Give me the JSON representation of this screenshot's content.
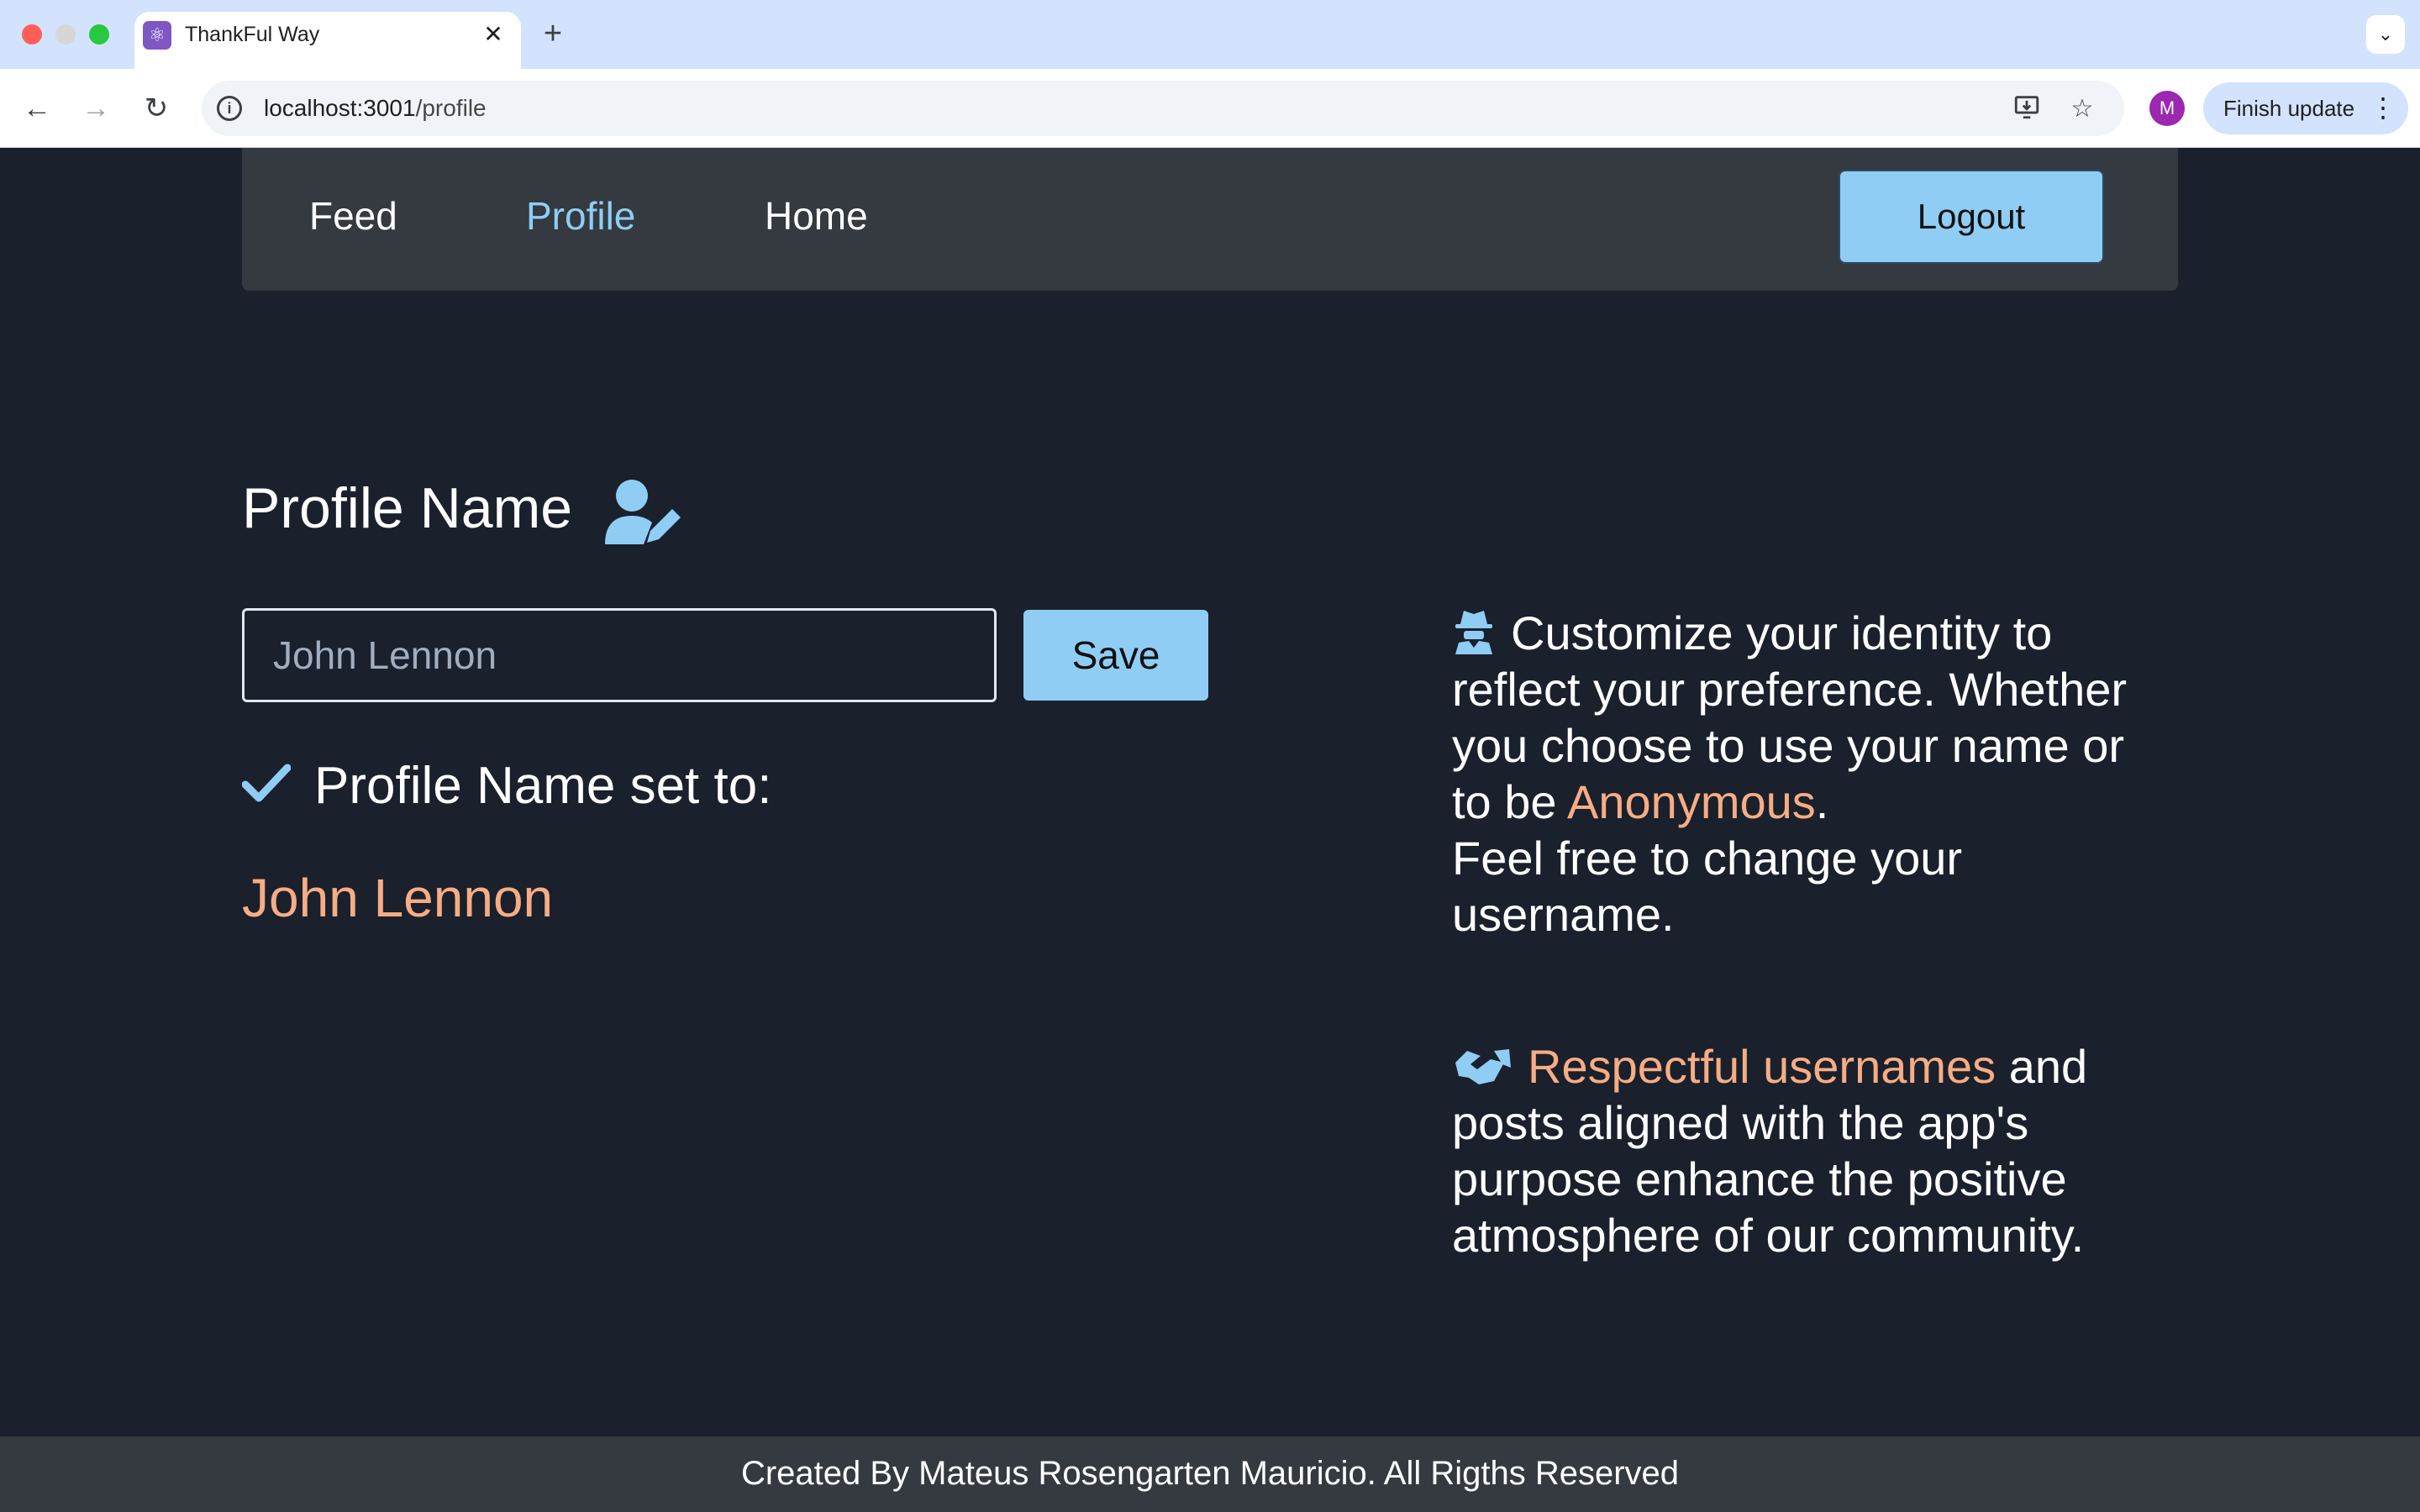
{
  "browser": {
    "tab_title": "ThankFul Way",
    "tab_close": "✕",
    "new_tab": "+",
    "tab_search": "⌄",
    "url_host": "localhost:3001",
    "url_path": "/profile",
    "avatar_letter": "M",
    "finish_update_label": "Finish update",
    "menu_dots": "⋮"
  },
  "nav": {
    "links": [
      {
        "label": "Feed",
        "active": false
      },
      {
        "label": "Profile",
        "active": true
      },
      {
        "label": "Home",
        "active": false
      }
    ],
    "logout_label": "Logout"
  },
  "profile": {
    "title": "Profile Name",
    "input_value": "John Lennon",
    "save_label": "Save",
    "set_label": "Profile Name set to:",
    "current_name": "John Lennon"
  },
  "info": {
    "p1_pre": "Customize your identity to reflect your preference. Whether you choose to use your name or to be ",
    "p1_accent": "Anonymous",
    "p1_post": ".",
    "p1_line2": "Feel free to change your username.",
    "p2_accent": "Respectful usernames",
    "p2_post": " and posts aligned with the app's purpose enhance the positive atmosphere of our community."
  },
  "footer": {
    "text": "Created By Mateus Rosengarten Mauricio. All Rigths Reserved"
  },
  "colors": {
    "background": "#1a202c",
    "navbar": "#343a40",
    "accent_blue": "#90cdf4",
    "accent_orange": "#f6ad84"
  },
  "icons": {
    "favicon": "react-logo-icon",
    "title_icon": "user-edit-icon",
    "check": "check-icon",
    "info_1": "user-secret-icon",
    "info_2": "handshake-icon"
  }
}
